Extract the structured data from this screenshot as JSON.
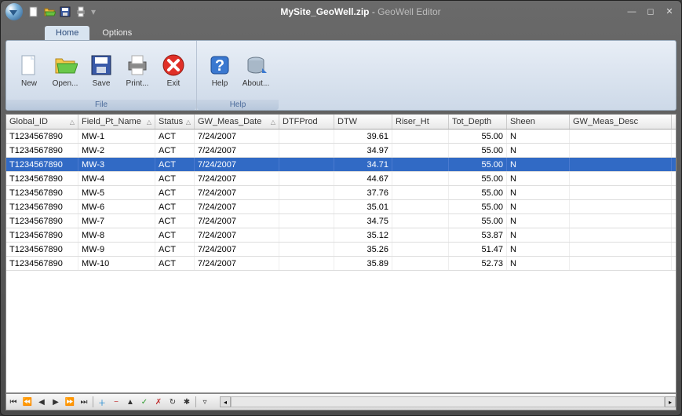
{
  "title": {
    "filename": "MySite_GeoWell.zip",
    "separator": " - ",
    "app": "GeoWell Editor"
  },
  "tabs": [
    {
      "label": "Home",
      "active": true
    },
    {
      "label": "Options",
      "active": false
    }
  ],
  "ribbon": {
    "groups": [
      {
        "label": "File",
        "buttons": [
          {
            "label": "New",
            "icon": "new"
          },
          {
            "label": "Open...",
            "icon": "open"
          },
          {
            "label": "Save",
            "icon": "save"
          },
          {
            "label": "Print...",
            "icon": "print"
          },
          {
            "label": "Exit",
            "icon": "exit"
          }
        ]
      },
      {
        "label": "Help",
        "buttons": [
          {
            "label": "Help",
            "icon": "help"
          },
          {
            "label": "About...",
            "icon": "about"
          }
        ]
      }
    ]
  },
  "columns": [
    "Global_ID",
    "Field_Pt_Name",
    "Status",
    "GW_Meas_Date",
    "DTFProd",
    "DTW",
    "Riser_Ht",
    "Tot_Depth",
    "Sheen",
    "GW_Meas_Desc"
  ],
  "rows": [
    {
      "Global_ID": "T1234567890",
      "Field_Pt_Name": "MW-1",
      "Status": "ACT",
      "GW_Meas_Date": "7/24/2007",
      "DTFProd": "",
      "DTW": "39.61",
      "Riser_Ht": "",
      "Tot_Depth": "55.00",
      "Sheen": "N",
      "GW_Meas_Desc": ""
    },
    {
      "Global_ID": "T1234567890",
      "Field_Pt_Name": "MW-2",
      "Status": "ACT",
      "GW_Meas_Date": "7/24/2007",
      "DTFProd": "",
      "DTW": "34.97",
      "Riser_Ht": "",
      "Tot_Depth": "55.00",
      "Sheen": "N",
      "GW_Meas_Desc": ""
    },
    {
      "Global_ID": "T1234567890",
      "Field_Pt_Name": "MW-3",
      "Status": "ACT",
      "GW_Meas_Date": "7/24/2007",
      "DTFProd": "",
      "DTW": "34.71",
      "Riser_Ht": "",
      "Tot_Depth": "55.00",
      "Sheen": "N",
      "GW_Meas_Desc": "",
      "selected": true
    },
    {
      "Global_ID": "T1234567890",
      "Field_Pt_Name": "MW-4",
      "Status": "ACT",
      "GW_Meas_Date": "7/24/2007",
      "DTFProd": "",
      "DTW": "44.67",
      "Riser_Ht": "",
      "Tot_Depth": "55.00",
      "Sheen": "N",
      "GW_Meas_Desc": ""
    },
    {
      "Global_ID": "T1234567890",
      "Field_Pt_Name": "MW-5",
      "Status": "ACT",
      "GW_Meas_Date": "7/24/2007",
      "DTFProd": "",
      "DTW": "37.76",
      "Riser_Ht": "",
      "Tot_Depth": "55.00",
      "Sheen": "N",
      "GW_Meas_Desc": ""
    },
    {
      "Global_ID": "T1234567890",
      "Field_Pt_Name": "MW-6",
      "Status": "ACT",
      "GW_Meas_Date": "7/24/2007",
      "DTFProd": "",
      "DTW": "35.01",
      "Riser_Ht": "",
      "Tot_Depth": "55.00",
      "Sheen": "N",
      "GW_Meas_Desc": ""
    },
    {
      "Global_ID": "T1234567890",
      "Field_Pt_Name": "MW-7",
      "Status": "ACT",
      "GW_Meas_Date": "7/24/2007",
      "DTFProd": "",
      "DTW": "34.75",
      "Riser_Ht": "",
      "Tot_Depth": "55.00",
      "Sheen": "N",
      "GW_Meas_Desc": ""
    },
    {
      "Global_ID": "T1234567890",
      "Field_Pt_Name": "MW-8",
      "Status": "ACT",
      "GW_Meas_Date": "7/24/2007",
      "DTFProd": "",
      "DTW": "35.12",
      "Riser_Ht": "",
      "Tot_Depth": "53.87",
      "Sheen": "N",
      "GW_Meas_Desc": ""
    },
    {
      "Global_ID": "T1234567890",
      "Field_Pt_Name": "MW-9",
      "Status": "ACT",
      "GW_Meas_Date": "7/24/2007",
      "DTFProd": "",
      "DTW": "35.26",
      "Riser_Ht": "",
      "Tot_Depth": "51.47",
      "Sheen": "N",
      "GW_Meas_Desc": ""
    },
    {
      "Global_ID": "T1234567890",
      "Field_Pt_Name": "MW-10",
      "Status": "ACT",
      "GW_Meas_Date": "7/24/2007",
      "DTFProd": "",
      "DTW": "35.89",
      "Riser_Ht": "",
      "Tot_Depth": "52.73",
      "Sheen": "N",
      "GW_Meas_Desc": ""
    }
  ],
  "numeric_cols": [
    "DTW",
    "Tot_Depth"
  ]
}
